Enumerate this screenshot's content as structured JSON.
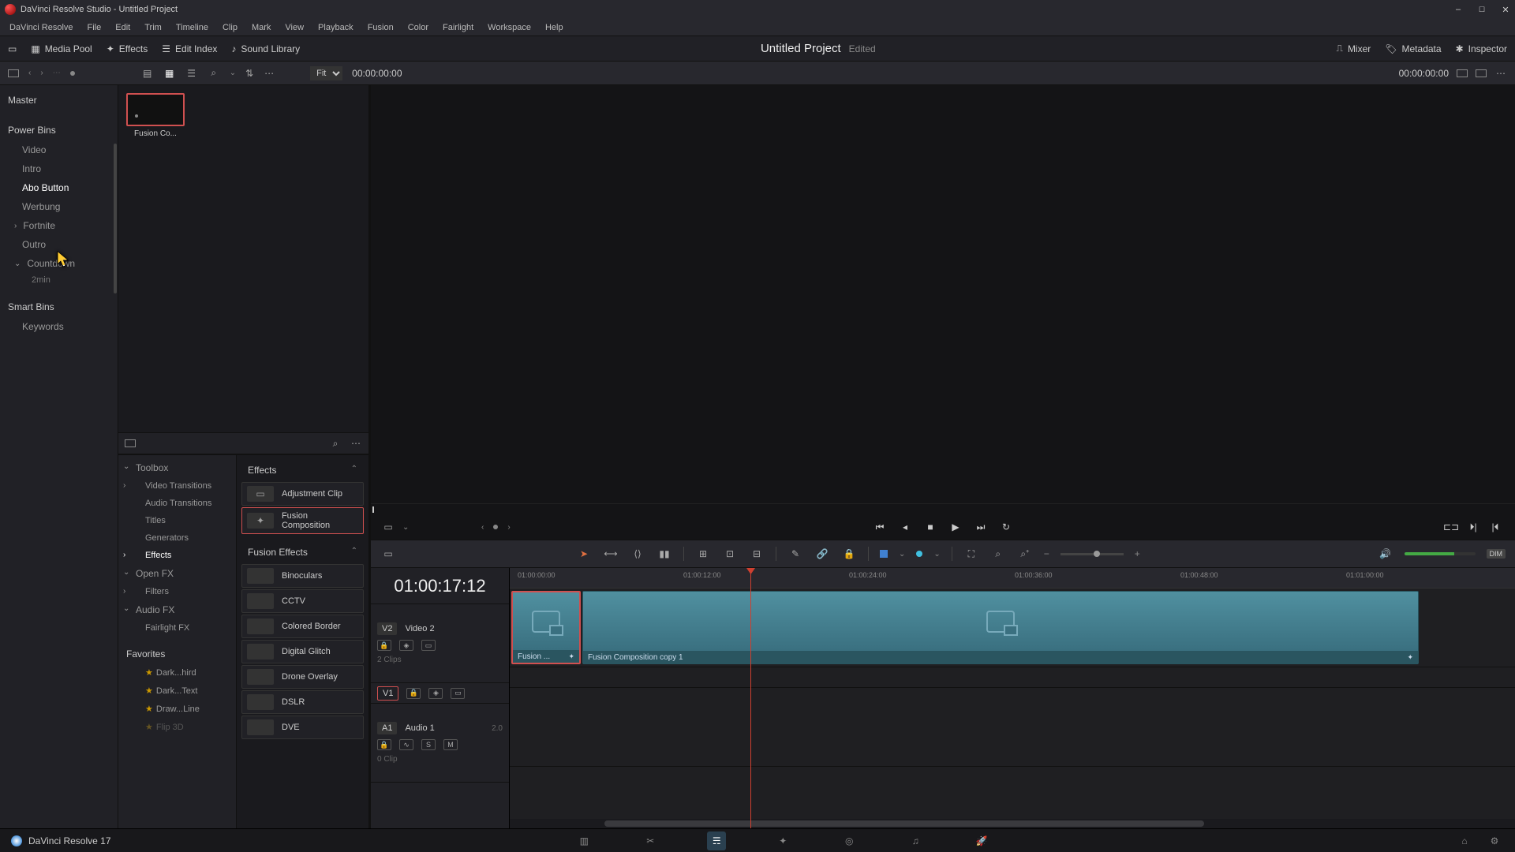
{
  "titlebar": {
    "title": "DaVinci Resolve Studio - Untitled Project"
  },
  "menus": [
    "DaVinci Resolve",
    "File",
    "Edit",
    "Trim",
    "Timeline",
    "Clip",
    "Mark",
    "View",
    "Playback",
    "Fusion",
    "Color",
    "Fairlight",
    "Workspace",
    "Help"
  ],
  "toolbar": {
    "media_pool": "Media Pool",
    "effects": "Effects",
    "edit_index": "Edit Index",
    "sound_library": "Sound Library",
    "project": "Untitled Project",
    "edited": "Edited",
    "mixer": "Mixer",
    "metadata": "Metadata",
    "inspector": "Inspector"
  },
  "subbar": {
    "fit": "Fit",
    "tc_left": "00:00:00:00",
    "tc_right": "00:00:00:00"
  },
  "bins": {
    "master": "Master",
    "power_bins": "Power Bins",
    "items": [
      "Video",
      "Intro",
      "Abo Button",
      "Werbung",
      "Fortnite",
      "Outro",
      "Countdown"
    ],
    "countdown_sub": "2min",
    "smart_bins": "Smart Bins",
    "keywords": "Keywords"
  },
  "thumb": {
    "label": "Fusion Co..."
  },
  "fx_tree": {
    "toolbox": "Toolbox",
    "items": [
      "Video Transitions",
      "Audio Transitions",
      "Titles",
      "Generators",
      "Effects"
    ],
    "openfx": "Open FX",
    "filters": "Filters",
    "audiofx": "Audio FX",
    "fairlight": "Fairlight FX",
    "favorites": "Favorites",
    "favs": [
      "Dark...hird",
      "Dark...Text",
      "Draw...Line",
      "Flip 3D"
    ]
  },
  "fx_list": {
    "cat1": "Effects",
    "adj": "Adjustment Clip",
    "fusion_comp": "Fusion Composition",
    "cat2": "Fusion Effects",
    "rows": [
      "Binoculars",
      "CCTV",
      "Colored Border",
      "Digital Glitch",
      "Drone Overlay",
      "DSLR",
      "DVE"
    ]
  },
  "timeline": {
    "big_tc": "01:00:17:12",
    "ruler": [
      "01:00:00:00",
      "01:00:12:00",
      "01:00:24:00",
      "01:00:36:00",
      "01:00:48:00",
      "01:01:00:00"
    ],
    "v2": {
      "label": "V2",
      "name": "Video 2",
      "meta": "2 Clips"
    },
    "v1": {
      "label": "V1"
    },
    "a1": {
      "label": "A1",
      "name": "Audio 1",
      "ch": "2.0",
      "meta": "0 Clip"
    },
    "clip1": "Fusion ...",
    "clip2": "Fusion Composition copy 1",
    "solo": "S",
    "mute": "M"
  },
  "toolbar2": {
    "dim": "DIM"
  },
  "bottom": {
    "version": "DaVinci Resolve 17"
  }
}
